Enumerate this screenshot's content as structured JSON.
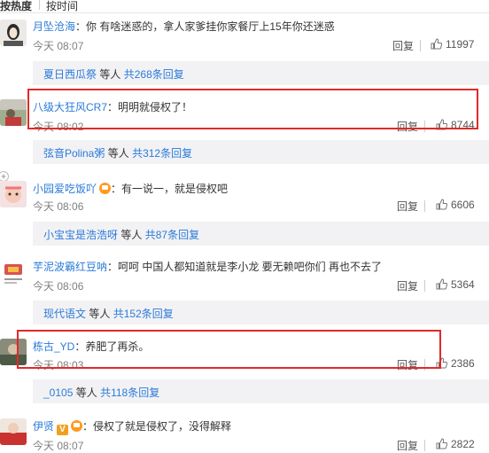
{
  "header": {
    "sort_hot": "按热度",
    "sort_time": "按时间"
  },
  "labels": {
    "reply": "回复",
    "suffix": "等人",
    "total_prefix": "共",
    "total_suffix": "条回复"
  },
  "comments": [
    {
      "user": "月坠沧海",
      "text": "：你 有啥迷惑的，拿人家爹挂你家餐厅上15年你还迷惑",
      "time": "今天 08:07",
      "likes": "11997",
      "sub": {
        "user": "夏日西瓜祭",
        "count": "268"
      }
    },
    {
      "user": "八级大狂风CR7",
      "text": "：明明就侵权了！",
      "time": "今天 08:02",
      "likes": "8744",
      "sub": {
        "user": "弦音Polina粥",
        "count": "312"
      }
    },
    {
      "user": "小园爱吃饭吖",
      "text": "：有一说一，就是侵权吧",
      "time": "今天 08:06",
      "likes": "6606",
      "sub": {
        "user": "小宝宝是浩浩呀",
        "count": "87"
      }
    },
    {
      "user": "芋泥波霸红豆呐",
      "text": "：呵呵 中国人都知道就是李小龙 要无赖吧你们 再也不去了",
      "time": "今天 08:06",
      "likes": "5364",
      "sub": {
        "user": "现代语文",
        "count": "152"
      }
    },
    {
      "user": "栋古_YD",
      "text": "：养肥了再杀。",
      "time": "今天 08:03",
      "likes": "2386",
      "sub": {
        "user": "_0105",
        "count": "118"
      }
    },
    {
      "user": "伊贤",
      "badge": "V",
      "text": "：侵权了就是侵权了，没得解释",
      "time": "今天 08:07",
      "likes": "2822"
    }
  ],
  "colors": {
    "link": "#2b7bd8",
    "highlight": "#e02a2a",
    "subbg": "#f2f2f5"
  }
}
